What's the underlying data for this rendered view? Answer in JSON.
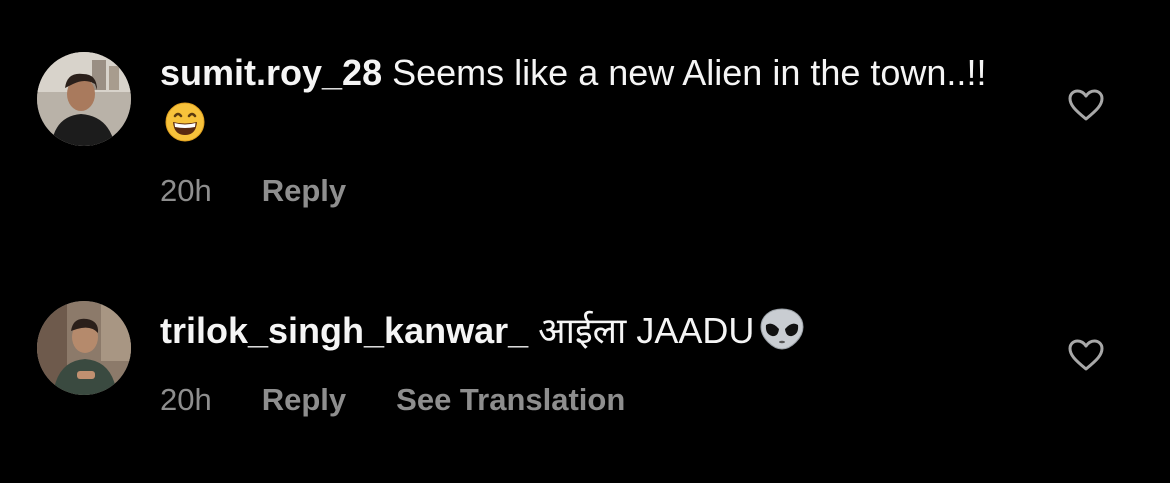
{
  "comments": [
    {
      "username": "sumit.roy_28",
      "text": "Seems like a new Alien in the town..!!",
      "emoji": "grinning-face-with-smiling-eyes",
      "time": "20h",
      "reply_label": "Reply",
      "translation_label": ""
    },
    {
      "username": "trilok_singh_kanwar_",
      "text": "आईला JAADU",
      "emoji": "alien",
      "time": "20h",
      "reply_label": "Reply",
      "translation_label": "See Translation"
    }
  ],
  "colors": {
    "background": "#000000",
    "text": "#f5f5f5",
    "secondary": "#8e8e8e"
  },
  "icons": {
    "like": "heart-outline-icon"
  }
}
